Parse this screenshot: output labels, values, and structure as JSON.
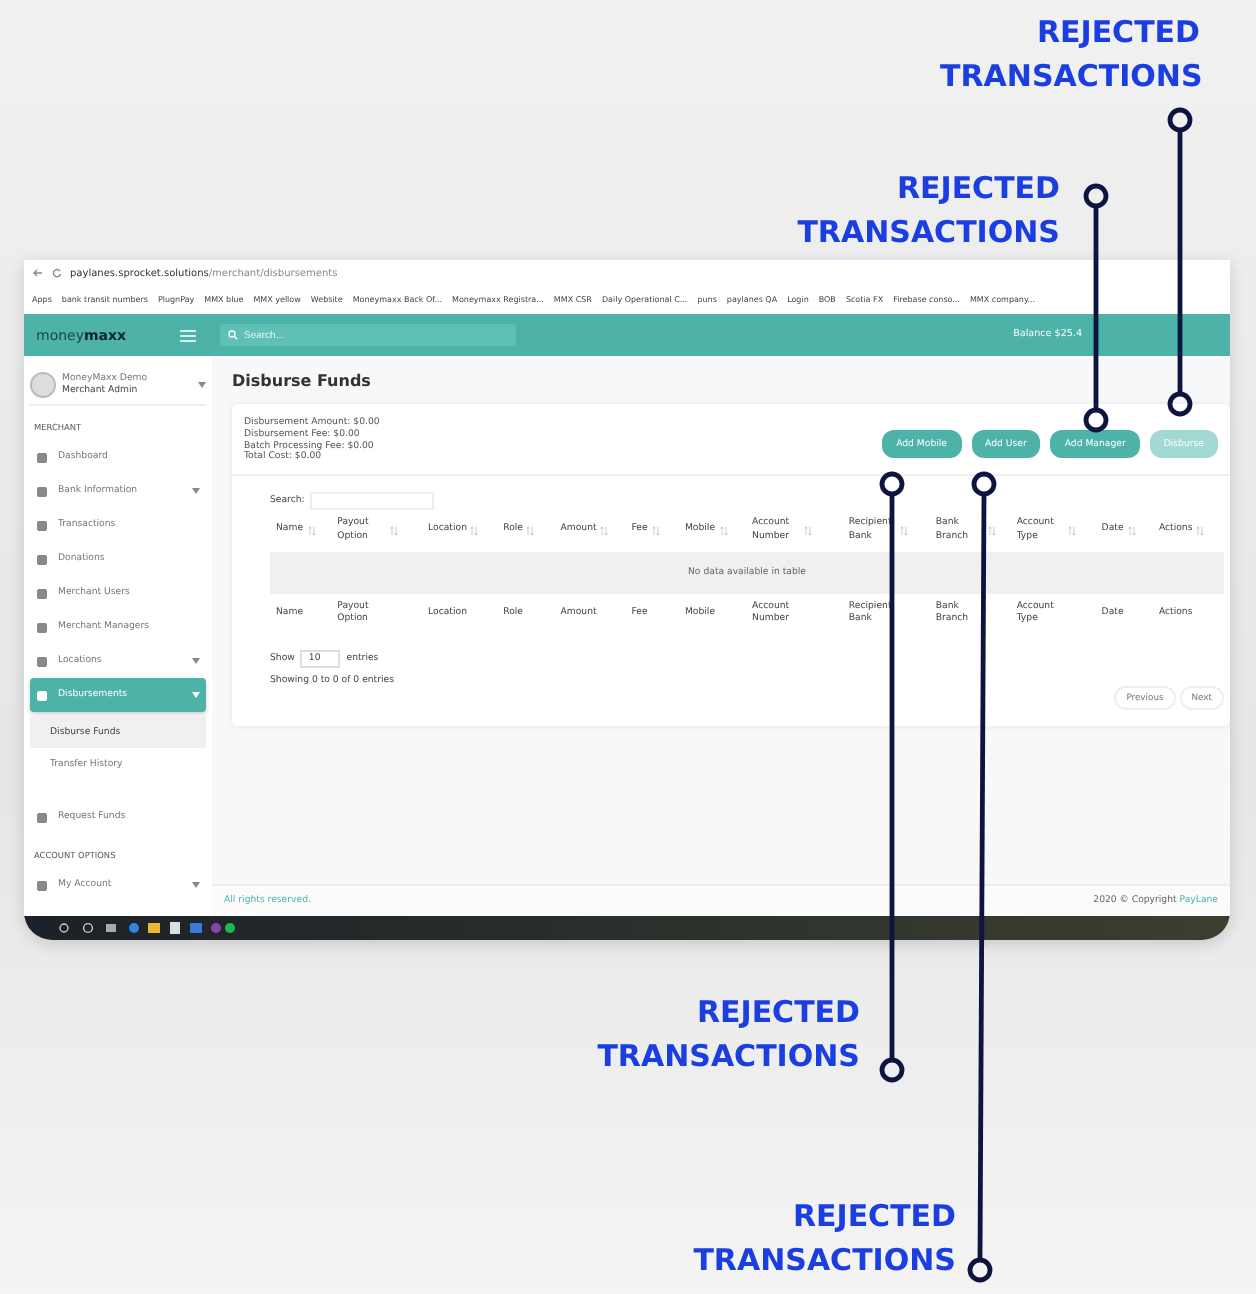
{
  "callouts": [
    {
      "text": "REJECTED TRANSACTIONS"
    },
    {
      "text": "REJECTED TRANSACTIONS"
    },
    {
      "text": "REJECTED TRANSACTIONS"
    },
    {
      "text": "REJECTED TRANSACTIONS"
    }
  ],
  "browser": {
    "url_host": "paylanes.sprocket.solutions",
    "url_path": "/merchant/disbursements",
    "bookmarks": [
      "Apps",
      "bank transit numbers",
      "PlugnPay",
      "MMX blue",
      "MMX yellow",
      "Website",
      "Moneymaxx Back Of...",
      "Moneymaxx Registra...",
      "MMX CSR",
      "Daily Operational C...",
      "puns",
      "paylanes QA",
      "Login",
      "BOB",
      "Scotia FX",
      "Firebase conso...",
      "MMX company..."
    ]
  },
  "header": {
    "logo_light": "money",
    "logo_bold": "maxx",
    "search": {
      "placeholder": "Search..."
    },
    "balance": "Balance $25.4"
  },
  "sidebar": {
    "user": {
      "name": "MoneyMaxx Demo",
      "role": "Merchant Admin"
    },
    "items": [
      {
        "kind": "heading",
        "label": "MERCHANT"
      },
      {
        "kind": "item",
        "label": "Dashboard",
        "selected": false,
        "expandable": false
      },
      {
        "kind": "item",
        "label": "Bank Information",
        "selected": false,
        "expandable": true
      },
      {
        "kind": "item",
        "label": "Transactions",
        "selected": false,
        "expandable": false
      },
      {
        "kind": "item",
        "label": "Donations",
        "selected": false,
        "expandable": false
      },
      {
        "kind": "item",
        "label": "Merchant Users",
        "selected": false,
        "expandable": false
      },
      {
        "kind": "item",
        "label": "Merchant Managers",
        "selected": false,
        "expandable": false
      },
      {
        "kind": "item",
        "label": "Locations",
        "selected": false,
        "expandable": true
      },
      {
        "kind": "item",
        "label": "Disbursements",
        "selected": true,
        "expandable": true,
        "children": [
          {
            "label": "Disburse Funds",
            "selected": true
          },
          {
            "label": "Transfer History",
            "selected": false
          }
        ]
      },
      {
        "kind": "item",
        "label": "Request Funds",
        "selected": false,
        "expandable": false
      },
      {
        "kind": "heading",
        "label": "ACCOUNT OPTIONS"
      },
      {
        "kind": "item",
        "label": "My Account",
        "selected": false,
        "expandable": true
      }
    ]
  },
  "page": {
    "title": "Disburse Funds",
    "summary": [
      "Disbursement Amount: $0.00",
      "Disbursement Fee: $0.00",
      "Batch Processing Fee: $0.00",
      "Total Cost: $0.00"
    ],
    "buttons": [
      {
        "label": "Add Mobile",
        "disabled": false
      },
      {
        "label": "Add User",
        "disabled": false
      },
      {
        "label": "Add Manager",
        "disabled": false
      },
      {
        "label": "Disburse",
        "disabled": true
      }
    ],
    "table": {
      "search_label": "Search:",
      "columns": [
        "Name",
        "Payout Option",
        "Location",
        "Role",
        "Amount",
        "Fee",
        "Mobile",
        "Account Number",
        "Recipient Bank",
        "Bank Branch",
        "Account Type",
        "Date",
        "Actions"
      ],
      "empty_text": "No data available in table",
      "footer_columns": [
        "Name",
        "Payout Option",
        "Location",
        "Role",
        "Amount",
        "Fee",
        "Mobile",
        "Account Number",
        "Recipient Bank",
        "Bank Branch",
        "Account Type",
        "Date",
        "Actions"
      ],
      "length": {
        "before": "Show",
        "value": "10",
        "after": "entries"
      },
      "info": "Showing 0 to 0 of 0 entries",
      "pagination": [
        "Previous",
        "Next"
      ]
    }
  },
  "footer": {
    "left": "All rights reserved.",
    "right": "2020 © Copyright",
    "brand": "PayLane"
  }
}
